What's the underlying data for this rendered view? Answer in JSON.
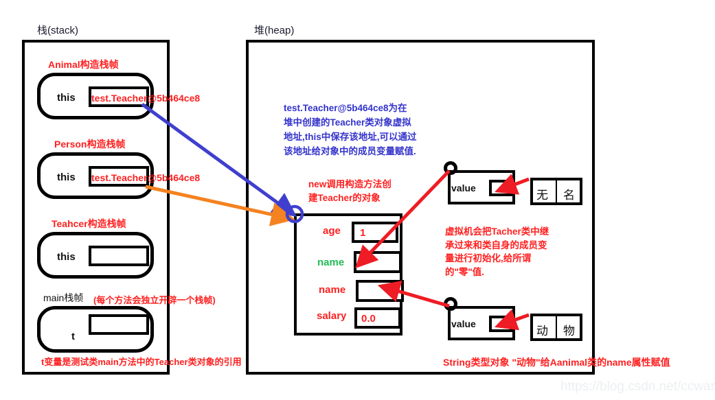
{
  "meta": {
    "watermark": "https://blog.csdn.net/ccwangfei"
  },
  "stack": {
    "title": "栈(stack)",
    "frames": [
      {
        "title": "Animal构造栈帧",
        "var_label": "this",
        "value": "test.Teacher@5b464ce8",
        "value_color": "#ff2020"
      },
      {
        "title": "Person构造栈帧",
        "var_label": "this",
        "value": "test.Teacher@5b464ce8",
        "value_color": "#ff2020"
      },
      {
        "title": "Teahcer构造栈帧",
        "var_label": "this",
        "value": "",
        "value_color": "#ff2020"
      },
      {
        "title": "main栈帧",
        "title_note": "(每个方法会独立开辟一个栈帧)",
        "var_label": "t",
        "value": "",
        "footer_note": "t变量是测试类main方法中的Teacher类对象的引用"
      }
    ]
  },
  "heap": {
    "title": "堆(heap)",
    "address_note_lines": [
      "test.Teacher@5b464ce8为在",
      "堆中创建的Teacher类对象虚拟",
      "地址,this中保存该地址,可以通过",
      "该地址给对象中的成员变量赋值."
    ],
    "new_note_lines": [
      "new调用构造方法创",
      "建Teacher的对象"
    ],
    "init_note_lines": [
      "虚拟机会把Tacher类中继",
      "承过来和类自身的成员变",
      "量进行初始化,给所谓",
      "的\"零\"值."
    ],
    "teacher_object": {
      "fields": [
        {
          "name": "age",
          "name_color": "#ff2020",
          "value": "1"
        },
        {
          "name": "name",
          "name_color": "#22bb55",
          "value": ""
        },
        {
          "name": "name",
          "name_color": "#ff2020",
          "value": ""
        },
        {
          "name": "salary",
          "name_color": "#ff2020",
          "value": "0.0"
        }
      ]
    },
    "strings": [
      {
        "field_label": "value",
        "field_value": "",
        "chars": [
          "无",
          "名"
        ]
      },
      {
        "field_label": "value",
        "field_value": "",
        "chars": [
          "动",
          "物"
        ]
      }
    ],
    "bottom_note": "String类型对象 \"动物\"给Aanimal类的name属性赋值"
  }
}
